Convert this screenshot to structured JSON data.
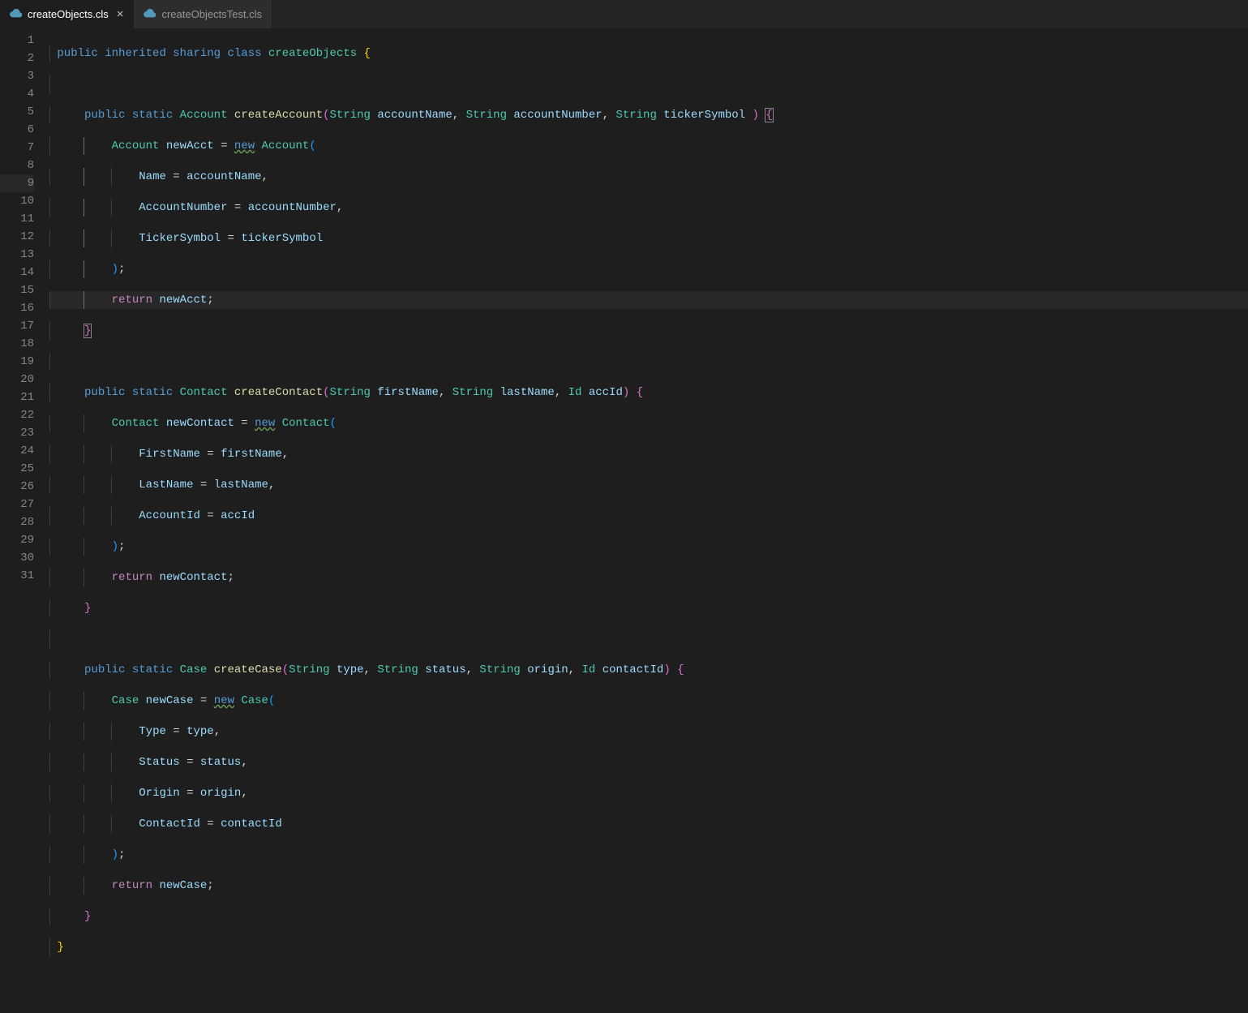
{
  "tabs": [
    {
      "label": "createObjects.cls",
      "active": true,
      "dirty": false
    },
    {
      "label": "createObjectsTest.cls",
      "active": false,
      "dirty": false
    }
  ],
  "lineCount": 31,
  "highlightedLine": 9,
  "lineNumbers": [
    "1",
    "2",
    "3",
    "4",
    "5",
    "6",
    "7",
    "8",
    "9",
    "10",
    "11",
    "12",
    "13",
    "14",
    "15",
    "16",
    "17",
    "18",
    "19",
    "20",
    "21",
    "22",
    "23",
    "24",
    "25",
    "26",
    "27",
    "28",
    "29",
    "30",
    "31"
  ],
  "code": {
    "language": "apex",
    "className": "createObjects",
    "classModifiers": [
      "public",
      "inherited",
      "sharing",
      "class"
    ],
    "methods": [
      {
        "modifiers": [
          "public",
          "static"
        ],
        "returnType": "Account",
        "name": "createAccount",
        "params": [
          {
            "type": "String",
            "name": "accountName"
          },
          {
            "type": "String",
            "name": "accountNumber"
          },
          {
            "type": "String",
            "name": "tickerSymbol"
          }
        ],
        "newType": "Account",
        "newVar": "newAcct",
        "assignments": [
          {
            "field": "Name",
            "value": "accountName"
          },
          {
            "field": "AccountNumber",
            "value": "accountNumber"
          },
          {
            "field": "TickerSymbol",
            "value": "tickerSymbol"
          }
        ],
        "returnVar": "newAcct"
      },
      {
        "modifiers": [
          "public",
          "static"
        ],
        "returnType": "Contact",
        "name": "createContact",
        "params": [
          {
            "type": "String",
            "name": "firstName"
          },
          {
            "type": "String",
            "name": "lastName"
          },
          {
            "type": "Id",
            "name": "accId"
          }
        ],
        "newType": "Contact",
        "newVar": "newContact",
        "assignments": [
          {
            "field": "FirstName",
            "value": "firstName"
          },
          {
            "field": "LastName",
            "value": "lastName"
          },
          {
            "field": "AccountId",
            "value": "accId"
          }
        ],
        "returnVar": "newContact"
      },
      {
        "modifiers": [
          "public",
          "static"
        ],
        "returnType": "Case",
        "name": "createCase",
        "params": [
          {
            "type": "String",
            "name": "type"
          },
          {
            "type": "String",
            "name": "status"
          },
          {
            "type": "String",
            "name": "origin"
          },
          {
            "type": "Id",
            "name": "contactId"
          }
        ],
        "newType": "Case",
        "newVar": "newCase",
        "assignments": [
          {
            "field": "Type",
            "value": "type"
          },
          {
            "field": "Status",
            "value": "status"
          },
          {
            "field": "Origin",
            "value": "origin"
          },
          {
            "field": "ContactId",
            "value": "contactId"
          }
        ],
        "returnVar": "newCase"
      }
    ]
  },
  "tokens": {
    "public": "public",
    "inherited": "inherited",
    "sharing": "sharing",
    "class": "class",
    "static": "static",
    "new": "new",
    "return": "return",
    "Account": "Account",
    "Contact": "Contact",
    "Case": "Case",
    "String": "String",
    "Id": "Id",
    "createObjects": "createObjects",
    "createAccount": "createAccount",
    "createContact": "createContact",
    "createCase": "createCase",
    "accountName": "accountName",
    "accountNumber": "accountNumber",
    "tickerSymbol": "tickerSymbol",
    "firstName": "firstName",
    "lastName": "lastName",
    "accId": "accId",
    "type": "type",
    "status": "status",
    "origin": "origin",
    "contactId": "contactId",
    "newAcct": "newAcct",
    "newContact": "newContact",
    "newCase": "newCase",
    "Name": "Name",
    "AccountNumber": "AccountNumber",
    "TickerSymbol": "TickerSymbol",
    "FirstName": "FirstName",
    "LastName": "LastName",
    "AccountId": "AccountId",
    "Type": "Type",
    "Status": "Status",
    "Origin": "Origin",
    "ContactId": "ContactId"
  }
}
